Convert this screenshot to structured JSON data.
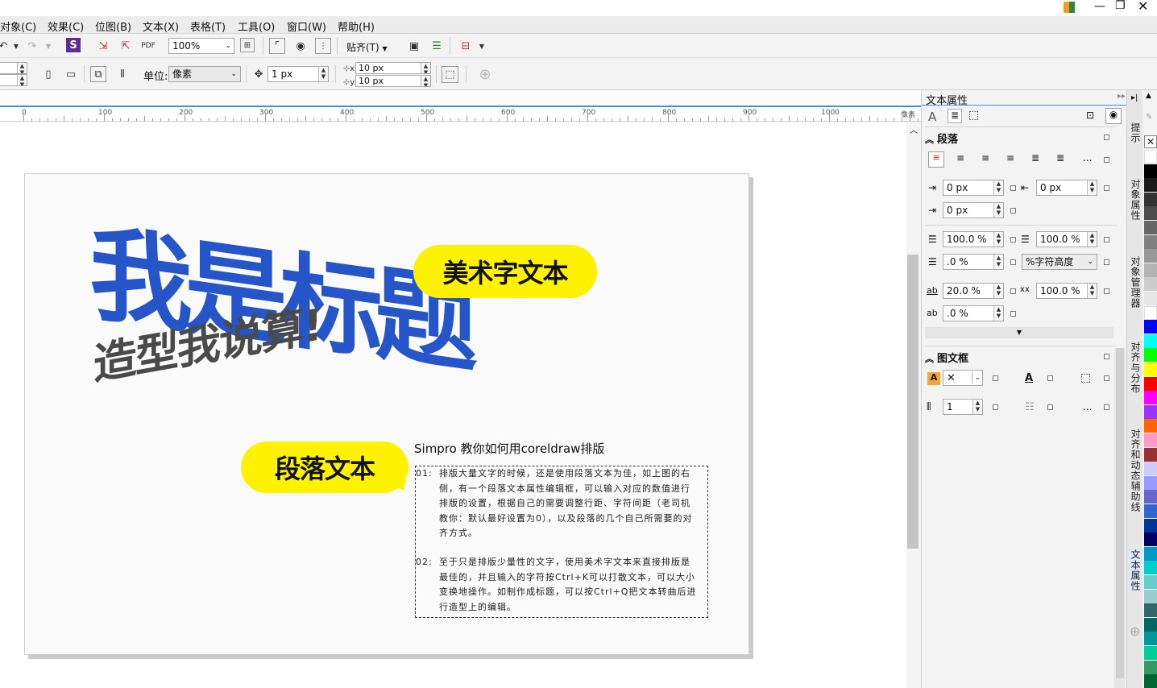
{
  "menu": [
    "对象(C)",
    "效果(C)",
    "位图(B)",
    "文本(X)",
    "表格(T)",
    "工具(O)",
    "窗口(W)",
    "帮助(H)"
  ],
  "toolbar": {
    "zoom": "100%",
    "snap_label": "贴齐(T)"
  },
  "propbar": {
    "unit_label": "单位:",
    "unit_value": "像素",
    "nudge_value": "1 px",
    "dup_x": "10 px",
    "dup_y": "10 px"
  },
  "ruler": {
    "labels": [
      "0",
      "100",
      "200",
      "300",
      "400",
      "500",
      "600",
      "700",
      "800",
      "900",
      "1000"
    ],
    "unit": "像素"
  },
  "artwork": {
    "title_big": "我是标题",
    "title_tag": "美术字文本",
    "subtitle": "造型我说算!",
    "para_tag": "段落文本",
    "para_heading": "Simpro 教你如何用coreldraw排版",
    "para1_num": "01:",
    "para1_lines": [
      "排版大量文字的时候，还是使用段落文本为佳，如上图的右",
      "侧，有一个段落文本属性编辑框，可以输入对应的数值进行",
      "排版的设置，根据自己的需要调整行距、字符间距（老司机",
      "教你：默认最好设置为0），以及段落的几个自己所需要的对",
      "齐方式。"
    ],
    "para2_num": "02:",
    "para2_lines": [
      "至于只是排版少量性的文字，使用美术字文本来直接排版是",
      "最佳的，并且输入的字符按Ctrl+K可以打散文本，可以大小",
      "变换地操作。如制作成标题，可以按Ctrl+Q把文本转曲后进",
      "行造型上的编辑。"
    ]
  },
  "docker": {
    "title": "文本属性",
    "paragraph_section": "段落",
    "indent_first": "0 px",
    "indent_right": "0 px",
    "indent_left": "0 px",
    "space_before": "100.0 %",
    "space_after": "100.0 %",
    "line_spacing": ".0 %",
    "line_unit": "%字符高度",
    "char_spacing": "20.0 %",
    "word_spacing": "100.0 %",
    "lang_spacing": ".0 %",
    "more": "...",
    "frame_section": "图文框",
    "columns": "1"
  },
  "side_tabs": [
    "提示",
    "对象属性",
    "对象管理器",
    "对齐与分布",
    "对齐和动态辅助线",
    "文本属性"
  ],
  "palette": [
    "#ffffff",
    "#000000",
    "#1a1a1a",
    "#333333",
    "#4d4d4d",
    "#666666",
    "#808080",
    "#999999",
    "#b3b3b3",
    "#cccccc",
    "#e6e6e6",
    "#ffffff",
    "#0000ff",
    "#00ffff",
    "#00ff00",
    "#ffff00",
    "#ff0000",
    "#ff00ff",
    "#9933ff",
    "#ff6600",
    "#ff99cc",
    "#993333",
    "#ccccff",
    "#9999ff",
    "#6666cc",
    "#3366cc",
    "#003399",
    "#000066",
    "#0099cc",
    "#00cccc",
    "#66cccc",
    "#99cccc",
    "#336666",
    "#006666",
    "#009999",
    "#00cc99",
    "#339966",
    "#006633"
  ]
}
